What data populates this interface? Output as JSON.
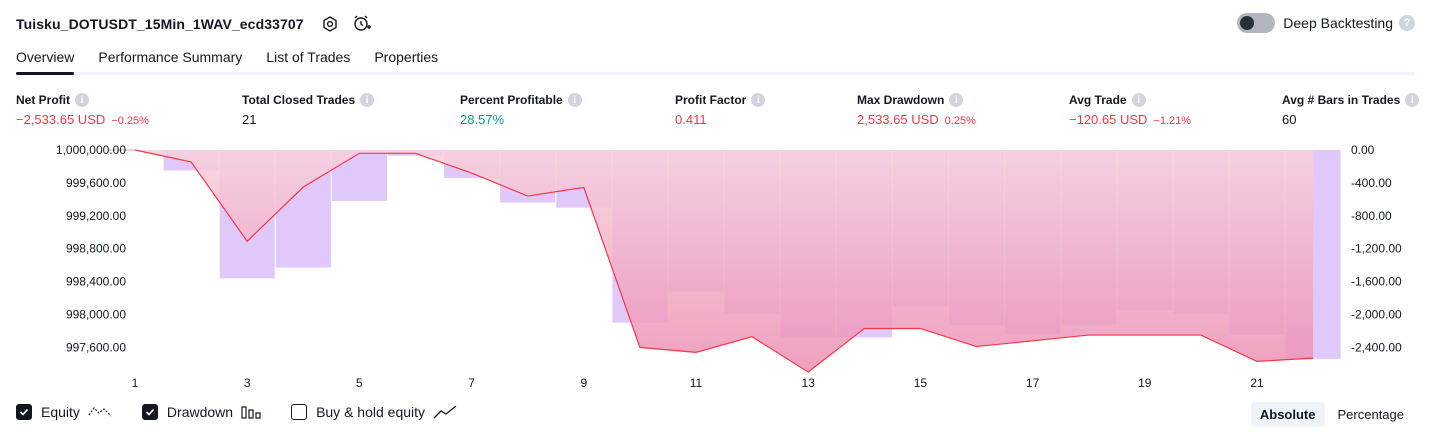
{
  "header": {
    "strategy_name": "Tuisku_DOTUSDT_15Min_1WAV_ecd33707",
    "deep_backtesting_label": "Deep Backtesting",
    "help_glyph": "?"
  },
  "tabs": [
    {
      "label": "Overview",
      "active": true
    },
    {
      "label": "Performance Summary",
      "active": false
    },
    {
      "label": "List of Trades",
      "active": false
    },
    {
      "label": "Properties",
      "active": false
    }
  ],
  "info_glyph": "i",
  "metrics": [
    {
      "label": "Net Profit",
      "value": "−2,533.65 USD",
      "sub": "−0.25%",
      "color": "red"
    },
    {
      "label": "Total Closed Trades",
      "value": "21",
      "sub": "",
      "color": "dark"
    },
    {
      "label": "Percent Profitable",
      "value": "28.57%",
      "sub": "",
      "color": "green"
    },
    {
      "label": "Profit Factor",
      "value": "0.411",
      "sub": "",
      "color": "red"
    },
    {
      "label": "Max Drawdown",
      "value": "2,533.65 USD",
      "sub": "0.25%",
      "color": "red"
    },
    {
      "label": "Avg Trade",
      "value": "−120.65 USD",
      "sub": "−1.21%",
      "color": "red"
    },
    {
      "label": "Avg # Bars in Trades",
      "value": "60",
      "sub": "",
      "color": "dark"
    }
  ],
  "chart_data": {
    "type": "line",
    "left_axis_ticks": [
      "1,000,000.00",
      "999,600.00",
      "999,200.00",
      "998,800.00",
      "998,400.00",
      "998,000.00",
      "997,600.00"
    ],
    "left_axis_values": [
      1000000,
      999600,
      999200,
      998800,
      998400,
      998000,
      997600
    ],
    "right_axis_ticks": [
      "0.00",
      "-400.00",
      "-800.00",
      "-1,200.00",
      "-1,600.00",
      "-2,000.00",
      "-2,400.00"
    ],
    "right_axis_values": [
      0,
      -400,
      -800,
      -1200,
      -1600,
      -2000,
      -2400
    ],
    "x_ticks": [
      "1",
      "3",
      "5",
      "7",
      "9",
      "11",
      "13",
      "15",
      "17",
      "19",
      "21"
    ],
    "x_tick_values": [
      1,
      3,
      5,
      7,
      9,
      11,
      13,
      15,
      17,
      19,
      21
    ],
    "ylim": [
      997450,
      1000030
    ],
    "series": [
      {
        "name": "Equity",
        "x": [
          1,
          2,
          3,
          4,
          5,
          6,
          7,
          8,
          9,
          10,
          11,
          12,
          13,
          14,
          15,
          16,
          17,
          18,
          19,
          20,
          21,
          22
        ],
        "values": [
          1000000,
          999855,
          998890,
          999550,
          999960,
          999960,
          999720,
          999440,
          999545,
          997600,
          997540,
          997730,
          997300,
          997830,
          997830,
          997610,
          997680,
          997750,
          997750,
          997750,
          997430,
          997470
        ]
      },
      {
        "name": "Drawdown",
        "x": [
          2,
          3,
          4,
          5,
          6,
          7,
          8,
          9,
          10,
          11,
          12,
          13,
          14,
          15,
          16,
          17,
          18,
          19,
          20,
          21,
          22
        ],
        "values": [
          -250,
          -1560,
          -1430,
          -620,
          -70,
          -340,
          -640,
          -700,
          -2100,
          -1720,
          -1990,
          -2280,
          -2280,
          -1900,
          -2130,
          -2240,
          -2120,
          -1950,
          -1990,
          -2250,
          -2540
        ]
      },
      {
        "name": "Buy & hold equity",
        "x": [],
        "values": []
      }
    ],
    "colors": {
      "equity_line": "#f23645",
      "drawdown_bar": "#e1c8fb",
      "equity_area_top": "#f8d1dc",
      "equity_area_bottom": "#ec8fb4"
    }
  },
  "legend": [
    {
      "label": "Equity",
      "checked": true,
      "icon": "equity-line-icon"
    },
    {
      "label": "Drawdown",
      "checked": true,
      "icon": "drawdown-bars-icon"
    },
    {
      "label": "Buy & hold equity",
      "checked": false,
      "icon": "buy-hold-line-icon"
    }
  ],
  "view_modes": {
    "absolute": "Absolute",
    "percentage": "Percentage",
    "active": "absolute"
  }
}
